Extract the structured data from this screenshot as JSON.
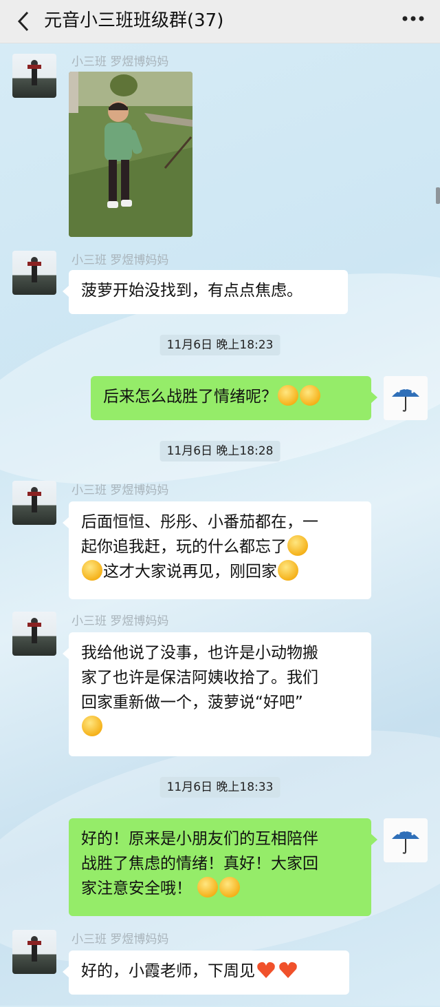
{
  "header": {
    "title": "元音小三班班级群(37)",
    "back_icon": "chevron-left-icon",
    "more_icon": "more-dots-icon"
  },
  "messages": [
    {
      "type": "image",
      "sender": "小三班 罗煜博妈妈",
      "side": "in"
    },
    {
      "type": "text",
      "sender": "小三班 罗煜博妈妈",
      "side": "in",
      "text": "菠萝开始没找到，有点点焦虑。"
    },
    {
      "type": "time",
      "text": "11月6日 晚上18:23"
    },
    {
      "type": "text",
      "side": "out",
      "text": "后来怎么战胜了情绪呢？"
    },
    {
      "type": "time",
      "text": "11月6日 晚上18:28"
    },
    {
      "type": "text",
      "sender": "小三班 罗煜博妈妈",
      "side": "in",
      "lines": [
        "后面恒恒、彤彤、小番茄都在，一",
        "起你追我赶，玩的什么都忘了",
        "这才大家说再见，刚回家"
      ]
    },
    {
      "type": "text",
      "sender": "小三班 罗煜博妈妈",
      "side": "in",
      "lines": [
        "我给他说了没事，也许是小动物搬",
        "家了也许是保洁阿姨收拾了。我们",
        "回家重新做一个，菠萝说“好吧”"
      ]
    },
    {
      "type": "time",
      "text": "11月6日 晚上18:33"
    },
    {
      "type": "text",
      "side": "out",
      "lines": [
        "好的！原来是小朋友们的互相陪伴",
        "战胜了焦虑的情绪！真好！大家回",
        "家注意安全哦！"
      ]
    },
    {
      "type": "text",
      "sender": "小三班 罗煜博妈妈",
      "side": "in",
      "text": "好的，小霞老师，下周见"
    }
  ],
  "colors": {
    "header_bg": "#ededed",
    "bubble_out": "#95ec69",
    "bubble_in": "#ffffff"
  }
}
